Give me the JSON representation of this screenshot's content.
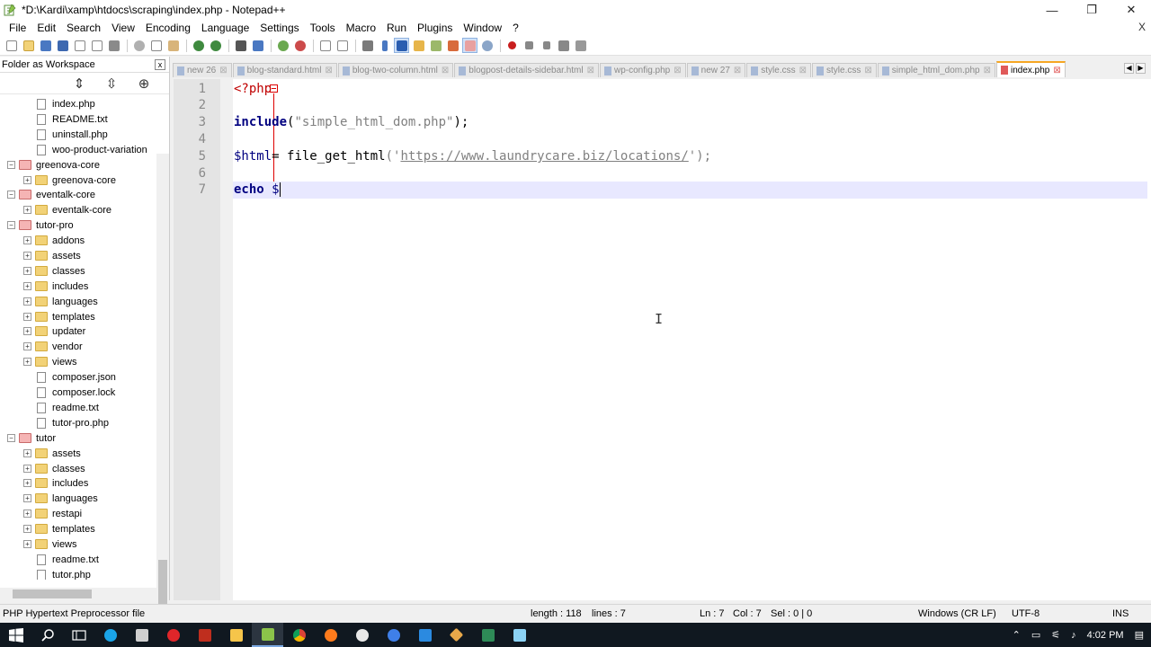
{
  "window": {
    "title": "*D:\\Kardi\\xamp\\htdocs\\scraping\\index.php - Notepad++",
    "minimize": "—",
    "maximize": "❐",
    "close": "✕"
  },
  "menu": {
    "items": [
      "File",
      "Edit",
      "Search",
      "View",
      "Encoding",
      "Language",
      "Settings",
      "Tools",
      "Macro",
      "Run",
      "Plugins",
      "Window",
      "?"
    ],
    "close_label": "X"
  },
  "toolbar": {
    "icons": [
      "new-file-icon",
      "open-file-icon",
      "save-icon",
      "save-all-icon",
      "close-icon",
      "close-all-icon",
      "print-icon",
      "cut-icon",
      "copy-icon",
      "paste-icon",
      "undo-icon",
      "redo-icon",
      "find-icon",
      "replace-icon",
      "zoom-in-icon",
      "zoom-out-icon",
      "sync-v-icon",
      "sync-h-icon",
      "word-wrap-icon",
      "show-all-chars-icon",
      "indent-guide-icon",
      "udl-icon",
      "doc-map-icon",
      "function-list-icon",
      "folder-workspace-icon",
      "monitor-icon",
      "record-macro-icon",
      "stop-macro-icon",
      "play-macro-icon",
      "run-macro-multiple-icon",
      "save-macro-icon"
    ]
  },
  "folder_panel": {
    "title": "Folder as Workspace",
    "close": "x",
    "tree": [
      {
        "label": "index.php",
        "type": "file",
        "depth": 2
      },
      {
        "label": "README.txt",
        "type": "file",
        "depth": 2
      },
      {
        "label": "uninstall.php",
        "type": "file",
        "depth": 2
      },
      {
        "label": "woo-product-variation",
        "type": "file",
        "depth": 2
      },
      {
        "label": "greenova-core",
        "type": "project",
        "depth": 0,
        "expanded": true
      },
      {
        "label": "greenova-core",
        "type": "folder",
        "depth": 1
      },
      {
        "label": "eventalk-core",
        "type": "project",
        "depth": 0,
        "expanded": true
      },
      {
        "label": "eventalk-core",
        "type": "folder",
        "depth": 1
      },
      {
        "label": "tutor-pro",
        "type": "project",
        "depth": 0,
        "expanded": true
      },
      {
        "label": "addons",
        "type": "folder",
        "depth": 1
      },
      {
        "label": "assets",
        "type": "folder",
        "depth": 1
      },
      {
        "label": "classes",
        "type": "folder",
        "depth": 1
      },
      {
        "label": "includes",
        "type": "folder",
        "depth": 1
      },
      {
        "label": "languages",
        "type": "folder",
        "depth": 1
      },
      {
        "label": "templates",
        "type": "folder",
        "depth": 1
      },
      {
        "label": "updater",
        "type": "folder",
        "depth": 1
      },
      {
        "label": "vendor",
        "type": "folder",
        "depth": 1
      },
      {
        "label": "views",
        "type": "folder",
        "depth": 1
      },
      {
        "label": "composer.json",
        "type": "file",
        "depth": 2
      },
      {
        "label": "composer.lock",
        "type": "file",
        "depth": 2
      },
      {
        "label": "readme.txt",
        "type": "file",
        "depth": 2
      },
      {
        "label": "tutor-pro.php",
        "type": "file",
        "depth": 2
      },
      {
        "label": "tutor",
        "type": "project",
        "depth": 0,
        "expanded": true
      },
      {
        "label": "assets",
        "type": "folder",
        "depth": 1
      },
      {
        "label": "classes",
        "type": "folder",
        "depth": 1
      },
      {
        "label": "includes",
        "type": "folder",
        "depth": 1
      },
      {
        "label": "languages",
        "type": "folder",
        "depth": 1
      },
      {
        "label": "restapi",
        "type": "folder",
        "depth": 1
      },
      {
        "label": "templates",
        "type": "folder",
        "depth": 1
      },
      {
        "label": "views",
        "type": "folder",
        "depth": 1
      },
      {
        "label": "readme.txt",
        "type": "file",
        "depth": 2
      },
      {
        "label": "tutor.php",
        "type": "file",
        "depth": 2
      }
    ]
  },
  "tabs": [
    {
      "label": "new 26",
      "active": false
    },
    {
      "label": "blog-standard.html",
      "active": false
    },
    {
      "label": "blog-two-column.html",
      "active": false
    },
    {
      "label": "blogpost-details-sidebar.html",
      "active": false
    },
    {
      "label": "wp-config.php",
      "active": false
    },
    {
      "label": "new 27",
      "active": false
    },
    {
      "label": "style.css",
      "active": false
    },
    {
      "label": "style.css",
      "active": false
    },
    {
      "label": "simple_html_dom.php",
      "active": false
    },
    {
      "label": "index.php",
      "active": true
    }
  ],
  "editor": {
    "line_numbers": [
      "1",
      "2",
      "3",
      "4",
      "5",
      "6",
      "7"
    ],
    "line1": "<?php",
    "line3_kw": "include",
    "line3_open": "(",
    "line3_str": "\"simple_html_dom.php\"",
    "line3_close": ");",
    "line5_var": "$html",
    "line5_eq": "= ",
    "line5_fn": "file_get_html",
    "line5_open": "('",
    "line5_url": "https://www.laundrycare.biz/locations/",
    "line5_close": "');",
    "line7_kw": "echo",
    "line7_rest": " $"
  },
  "status": {
    "file_type": "PHP Hypertext Preprocessor file",
    "length": "length : 118",
    "lines": "lines : 7",
    "ln": "Ln : 7",
    "col": "Col : 7",
    "sel": "Sel : 0 | 0",
    "eol": "Windows (CR LF)",
    "encoding": "UTF-8",
    "mode": "INS"
  },
  "taskbar": {
    "time": "4:02 PM"
  },
  "colors": {
    "active_tab_accent": "#f6a623",
    "php_tag": "#c00000",
    "keyword": "#000080",
    "string": "#808080",
    "current_line": "#e8e8ff",
    "taskbar_bg": "#101820"
  }
}
